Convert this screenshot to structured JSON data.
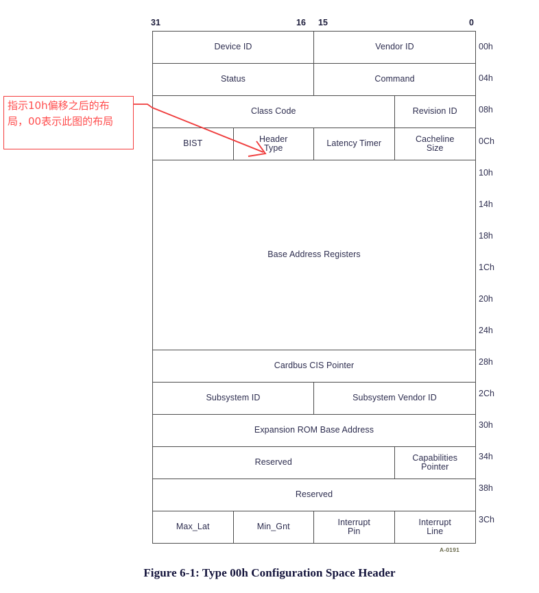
{
  "figure": {
    "code": "A-0191",
    "caption": "Figure 6-1:  Type 00h Configuration Space Header"
  },
  "bit_ruler": {
    "left_high": "31",
    "mid_high": "16",
    "mid_low": "15",
    "right_low": "0"
  },
  "annotation": {
    "text": "指示10h偏移之后的布局，00表示此图的布局",
    "border_color": "#f43c3c",
    "text_color": "#ff4d4d",
    "arrow_color": "#ef3b3b",
    "points_to": "Header Type"
  },
  "offsets": [
    "00h",
    "04h",
    "08h",
    "0Ch",
    "10h",
    "14h",
    "18h",
    "1Ch",
    "20h",
    "24h",
    "28h",
    "2Ch",
    "30h",
    "34h",
    "38h",
    "3Ch"
  ],
  "rows": [
    {
      "offset": "00h",
      "cells": [
        {
          "label": "Device ID",
          "width": "w-50"
        },
        {
          "label": "Vendor ID",
          "width": "w-50"
        }
      ]
    },
    {
      "offset": "04h",
      "cells": [
        {
          "label": "Status",
          "width": "w-50"
        },
        {
          "label": "Command",
          "width": "w-50"
        }
      ]
    },
    {
      "offset": "08h",
      "cells": [
        {
          "label": "Class Code",
          "width": "w-75"
        },
        {
          "label": "Revision ID",
          "width": "w-25"
        }
      ]
    },
    {
      "offset": "0Ch",
      "cells": [
        {
          "label": "BIST",
          "width": "w-25"
        },
        {
          "label": "Header\nType",
          "width": "w-25"
        },
        {
          "label": "Latency Timer",
          "width": "w-25"
        },
        {
          "label": "Cacheline\nSize",
          "width": "w-25"
        }
      ]
    },
    {
      "offset": "10h-24h",
      "cells": [
        {
          "label": "Base Address Registers",
          "width": "w-100"
        }
      ]
    },
    {
      "offset": "28h",
      "cells": [
        {
          "label": "Cardbus CIS Pointer",
          "width": "w-100"
        }
      ]
    },
    {
      "offset": "2Ch",
      "cells": [
        {
          "label": "Subsystem ID",
          "width": "w-50"
        },
        {
          "label": "Subsystem Vendor ID",
          "width": "w-50"
        }
      ]
    },
    {
      "offset": "30h",
      "cells": [
        {
          "label": "Expansion ROM Base Address",
          "width": "w-100"
        }
      ]
    },
    {
      "offset": "34h",
      "cells": [
        {
          "label": "Reserved",
          "width": "w-75"
        },
        {
          "label": "Capabilities\nPointer",
          "width": "w-25"
        }
      ]
    },
    {
      "offset": "38h",
      "cells": [
        {
          "label": "Reserved",
          "width": "w-100"
        }
      ]
    },
    {
      "offset": "3Ch",
      "cells": [
        {
          "label": "Max_Lat",
          "width": "w-25"
        },
        {
          "label": "Min_Gnt",
          "width": "w-25"
        },
        {
          "label": "Interrupt\nPin",
          "width": "w-25"
        },
        {
          "label": "Interrupt\nLine",
          "width": "w-25"
        }
      ]
    }
  ],
  "cells": {
    "device_id": "Device ID",
    "vendor_id": "Vendor ID",
    "status": "Status",
    "command": "Command",
    "class_code": "Class Code",
    "revision_id": "Revision ID",
    "bist": "BIST",
    "header_type_l1": "Header",
    "header_type_l2": "Type",
    "latency_timer": "Latency Timer",
    "cacheline_l1": "Cacheline",
    "cacheline_l2": "Size",
    "base_address_registers": "Base Address Registers",
    "cardbus_cis_pointer": "Cardbus CIS Pointer",
    "subsystem_id": "Subsystem ID",
    "subsystem_vendor_id": "Subsystem Vendor ID",
    "expansion_rom": "Expansion ROM Base Address",
    "reserved_34": "Reserved",
    "capabilities_l1": "Capabilities",
    "capabilities_l2": "Pointer",
    "reserved_38": "Reserved",
    "max_lat": "Max_Lat",
    "min_gnt": "Min_Gnt",
    "interrupt_pin_l1": "Interrupt",
    "interrupt_pin_l2": "Pin",
    "interrupt_line_l1": "Interrupt",
    "interrupt_line_l2": "Line"
  }
}
